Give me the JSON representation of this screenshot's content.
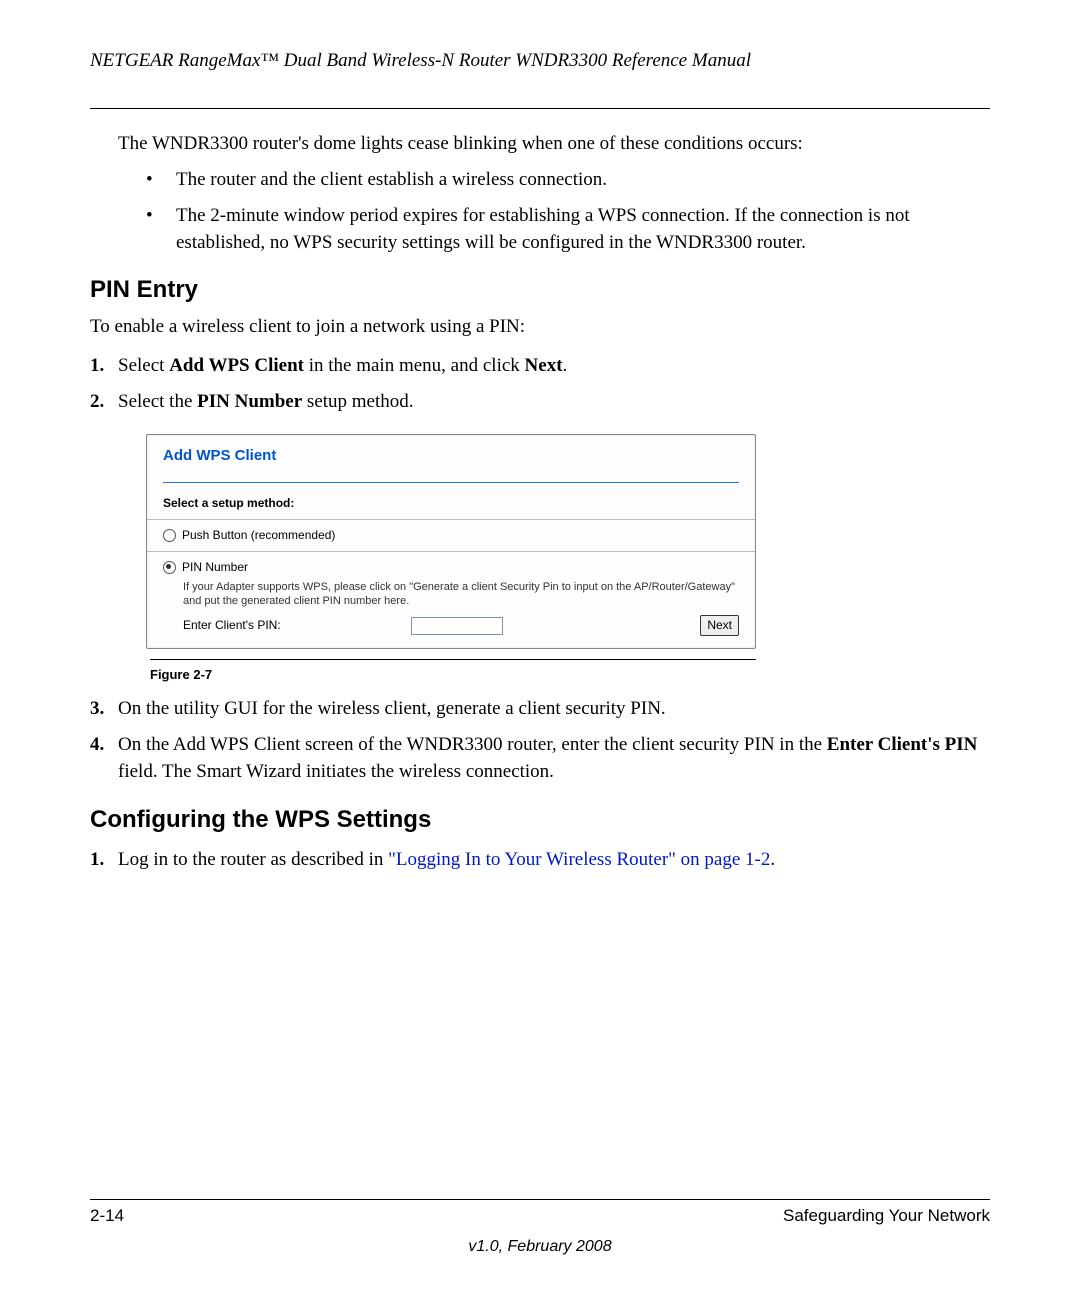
{
  "header": {
    "title": "NETGEAR RangeMax™ Dual Band Wireless-N Router WNDR3300 Reference Manual"
  },
  "intro_para": "The WNDR3300 router's dome lights cease blinking when one of these conditions occurs:",
  "bullets": [
    "The router and the client establish a wireless connection.",
    "The 2-minute window period expires for establishing a WPS connection. If the connection is not established, no WPS security settings will be configured in the WNDR3300 router."
  ],
  "section1": {
    "heading": "PIN Entry",
    "intro": "To enable a wireless client to join a network using a PIN:",
    "step1_pre": "Select ",
    "step1_b1": "Add WPS Client",
    "step1_mid": " in the main menu, and click ",
    "step1_b2": "Next",
    "step1_post": ".",
    "step2_pre": "Select the ",
    "step2_b": "PIN Number",
    "step2_post": " setup method.",
    "step3": "On the utility GUI for the wireless client, generate a client security PIN.",
    "step4_pre": "On the Add WPS Client screen of the WNDR3300 router, enter the client security PIN in the ",
    "step4_b": "Enter Client's PIN",
    "step4_post": " field. The Smart Wizard initiates the wireless connection."
  },
  "figure": {
    "title": "Add WPS Client",
    "select_label": "Select a setup method:",
    "opt1": "Push Button (recommended)",
    "opt2": "PIN Number",
    "note": "If your Adapter supports WPS, please click on \"Generate a client Security Pin to input on the AP/Router/Gateway\" and put the generated client PIN number here.",
    "pin_label": "Enter Client's PIN:",
    "next_btn": "Next",
    "caption": "Figure 2-7"
  },
  "section2": {
    "heading": "Configuring the WPS Settings",
    "step1_pre": "Log in to the router as described in ",
    "step1_link": "\"Logging In to Your Wireless Router\" on page 1-2",
    "step1_post": "."
  },
  "footer": {
    "page": "2-14",
    "chapter": "Safeguarding Your Network",
    "version": "v1.0, February 2008"
  }
}
